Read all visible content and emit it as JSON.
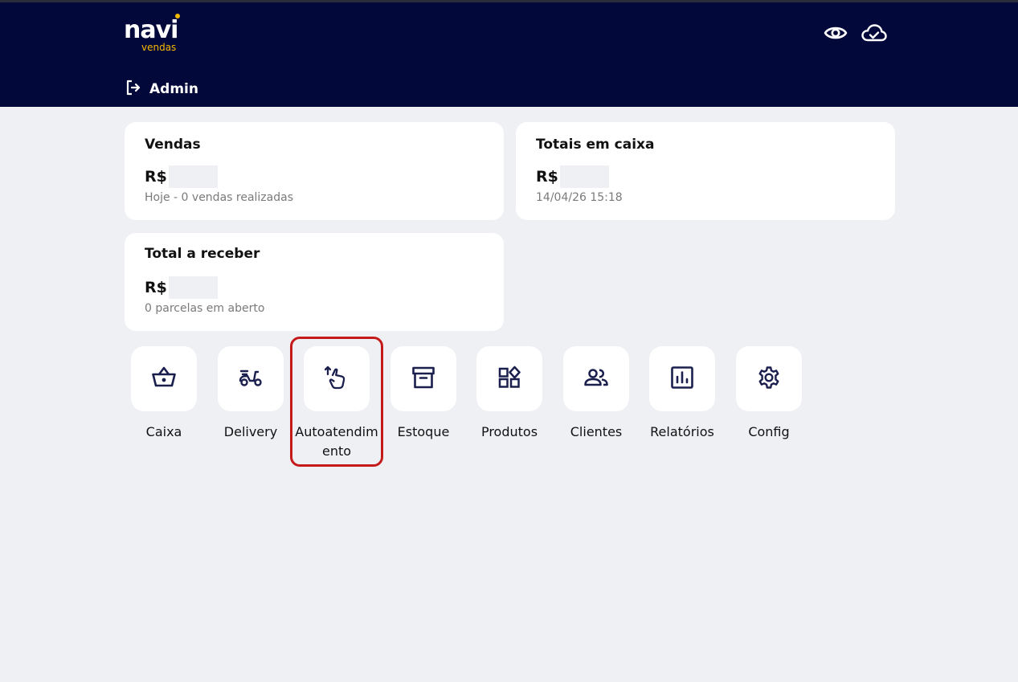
{
  "header": {
    "logo_main": "navi",
    "logo_sub": "vendas",
    "user_label": "Admin",
    "icons": [
      "eye-icon",
      "cloud-check-icon",
      "logout-icon"
    ]
  },
  "cards": {
    "vendas": {
      "title": "Vendas",
      "currency": "R$",
      "subtitle": "Hoje - 0 vendas realizadas"
    },
    "totais": {
      "title": "Totais em caixa",
      "currency": "R$",
      "subtitle": "14/04/26 15:18"
    },
    "receber": {
      "title": "Total a receber",
      "currency": "R$",
      "subtitle": "0 parcelas em aberto"
    }
  },
  "menu": [
    {
      "label": "Caixa",
      "icon": "basket-icon"
    },
    {
      "label": "Delivery",
      "icon": "scooter-icon"
    },
    {
      "label": "Autoatendimento",
      "icon": "touch-hand-icon"
    },
    {
      "label": "Estoque",
      "icon": "archive-box-icon"
    },
    {
      "label": "Produtos",
      "icon": "widgets-icon"
    },
    {
      "label": "Clientes",
      "icon": "people-icon"
    },
    {
      "label": "Relatórios",
      "icon": "bar-chart-icon"
    },
    {
      "label": "Config",
      "icon": "gear-icon"
    }
  ],
  "colors": {
    "header_bg": "#02093a",
    "accent": "#f5b800",
    "page_bg": "#eff0f4",
    "icon_color": "#1b1f4e",
    "highlight": "#c41a1a"
  }
}
